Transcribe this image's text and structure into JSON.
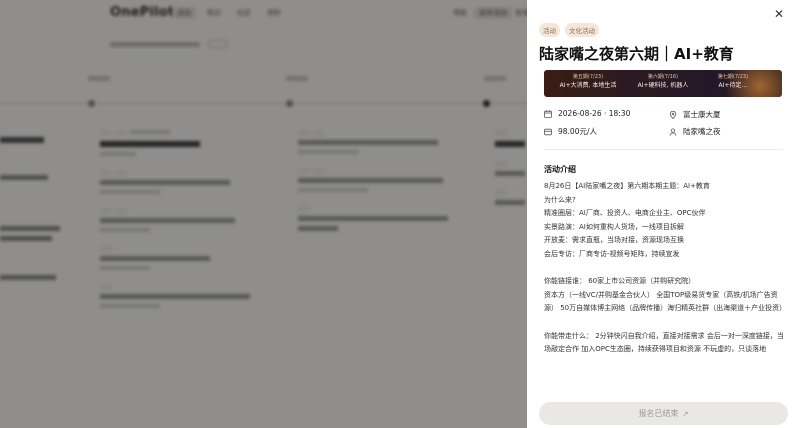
{
  "background": {
    "logo": "OnePilot",
    "nav": [
      "活动",
      "知识",
      "社区",
      "资料"
    ],
    "right": [
      "导航",
      "发布活动",
      "登录"
    ]
  },
  "drawer": {
    "tags": [
      "活动",
      "文化活动"
    ],
    "title": "陆家嘴之夜第六期｜AI+教育",
    "banner": [
      {
        "top": "第五期(7/23)",
        "bottom": "AI+大消费, 本地生活"
      },
      {
        "top": "第六期(7/16)",
        "bottom": "AI+硬科技, 机器人"
      },
      {
        "top": "第七期(7/23)",
        "bottom": "AI+待定…"
      }
    ],
    "datetime": "2026-08-26 · 18:30",
    "location": "富士康大厦",
    "price": "98.00元/人",
    "organizer": "陆家嘴之夜",
    "section_title": "活动介绍",
    "description": [
      "8月26日【AI陆家嘴之夜】第六期本期主题：AI+教育",
      "为什么来?",
      "精准圈层：AI厂商、投资人、电商企业主、OPC伙伴",
      "实景路演：AI如何重构人货场，一线项目拆解",
      "开放麦：需求直瓶，当场对接，资源现场互换",
      "会后专访：厂商专访-视频号矩阵，持续宣发",
      "",
      "你能链接谁：  60家上市公司资源（并购研究院）",
      "资本方（一线VC/并购基金合伙人） 全国TOP级易货专家（高铁/机场广告资源） 50万自媒体博主网络（品牌传播）海归精英社群（出海渠道＋产业投资）",
      "",
      "你能带走什么：  2分钟快闪自我介绍，直接对接需求 会后一对一深度链接，当场敲定合作 加入OPC生态圈，持续获得项目和资源 不玩虚的，只谈落地"
    ],
    "signup_label": "报名已结束",
    "signup_arrow": "↗",
    "close_label": "✕"
  }
}
